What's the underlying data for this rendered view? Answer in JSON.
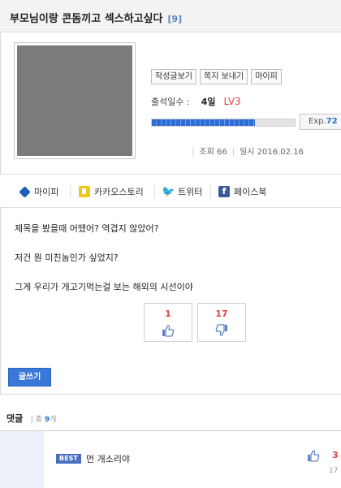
{
  "post": {
    "title": "부모님이랑 콘돔끼고 섹스하고싶다",
    "comment_count_badge": "[9]",
    "profile_buttons": [
      "작성글보기",
      "쪽지 보내기",
      "마이피"
    ],
    "attendance_label": "출석일수 :",
    "attendance_days": "4일",
    "level": "LV3",
    "exp_label": "Exp.",
    "exp_value": "72",
    "exp_fraction": 0.72,
    "views_label": "조회",
    "views": "66",
    "date_label": "일시",
    "date": "2016.02.16"
  },
  "share": [
    {
      "icon": "mypi-cube-icon",
      "label": "마이피"
    },
    {
      "icon": "kakaostory-icon",
      "label": "카카오스토리"
    },
    {
      "icon": "twitter-icon",
      "label": "트위터"
    },
    {
      "icon": "facebook-icon",
      "label": "페이스북"
    }
  ],
  "body_lines": [
    "제목을 봤을때 어땠어? 역겹지 않았어?",
    "저건 뭔 미친놈인가 싶었지?",
    "그게 우리가 개고기먹는걸 보는 해외의 시선이야"
  ],
  "votes": {
    "up": "1",
    "down": "17"
  },
  "write_button": "글쓰기",
  "comments": {
    "title": "댓글",
    "total_prefix": "총",
    "total": "9",
    "total_suffix": "개",
    "best": {
      "badge": "BEST",
      "text": "먼 개소리야",
      "likes": "3",
      "sub": "17"
    }
  },
  "colors": {
    "accent_blue": "#3a78d8",
    "level_red": "#e04141"
  }
}
